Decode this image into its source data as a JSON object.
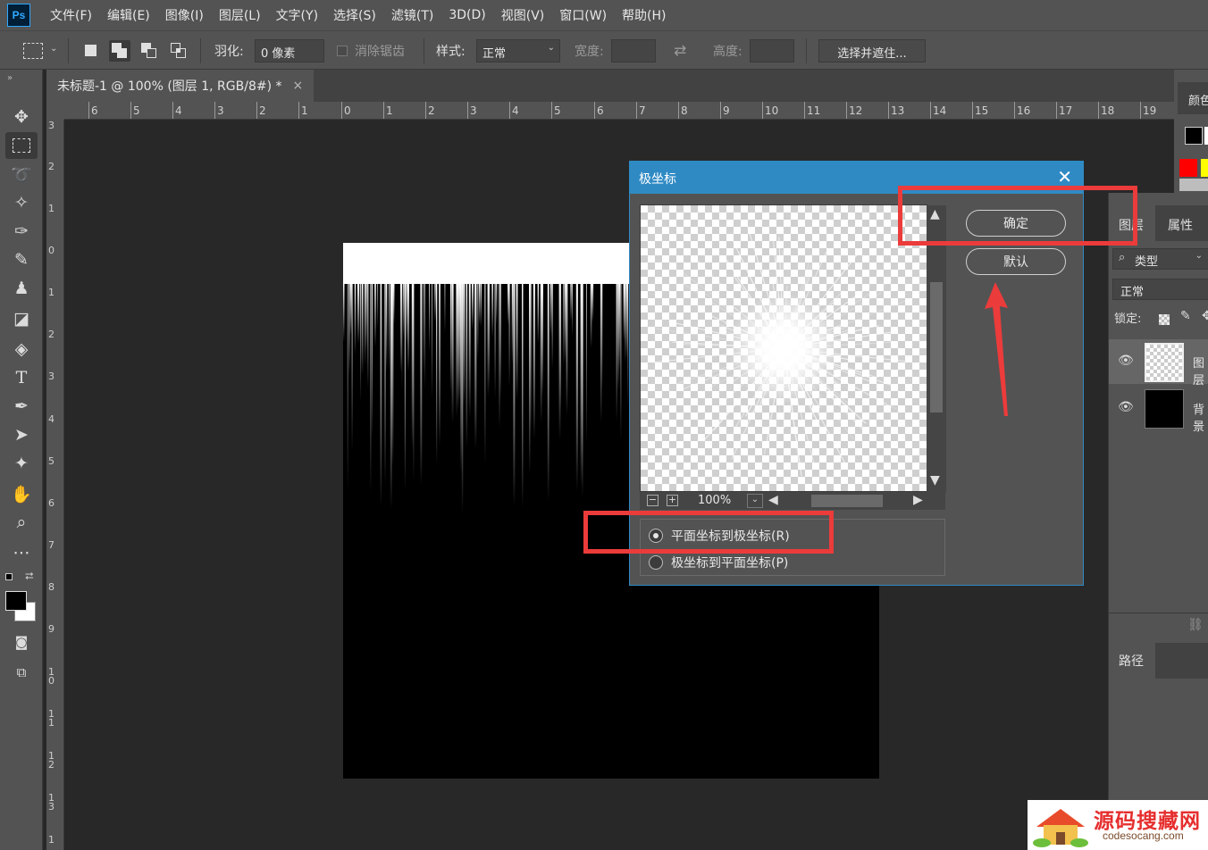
{
  "app": {
    "logo": "Ps"
  },
  "menu": [
    "文件(F)",
    "编辑(E)",
    "图像(I)",
    "图层(L)",
    "文字(Y)",
    "选择(S)",
    "滤镜(T)",
    "3D(D)",
    "视图(V)",
    "窗口(W)",
    "帮助(H)"
  ],
  "options": {
    "feather_label": "羽化:",
    "feather_value": "0 像素",
    "antialias_label": "消除锯齿",
    "style_label": "样式:",
    "style_value": "正常",
    "width_label": "宽度:",
    "height_label": "高度:",
    "select_mask_button": "选择并遮住..."
  },
  "document": {
    "tab_title": "未标题-1 @ 100% (图层 1, RGB/8#) *",
    "close": "×"
  },
  "rulers": {
    "h": [
      "6",
      "5",
      "4",
      "3",
      "2",
      "1",
      "0",
      "1",
      "2",
      "3",
      "4",
      "5",
      "6",
      "7",
      "8",
      "9",
      "10",
      "11",
      "12",
      "13",
      "14",
      "15",
      "16",
      "17",
      "18",
      "19"
    ],
    "v": [
      "3",
      "2",
      "1",
      "0",
      "1",
      "2",
      "3",
      "4",
      "5",
      "6",
      "7",
      "8",
      "9",
      "10",
      "11",
      "12",
      "13",
      "1"
    ]
  },
  "panels": {
    "color_tab": "颜色",
    "layers_tab": "图层",
    "properties_tab": "属性",
    "filter_kind": "类型",
    "blend_mode": "正常",
    "lock_label": "锁定:",
    "layer1_name": "图层",
    "background_name": "背景",
    "paths_tab": "路径"
  },
  "dialog": {
    "title": "极坐标",
    "close": "✕",
    "ok_button": "确定",
    "default_button": "默认",
    "zoom": "100%",
    "option_rect_to_polar": "平面坐标到极坐标(R)",
    "option_polar_to_rect": "极坐标到平面坐标(P)",
    "selected_option": "option_rect_to_polar"
  },
  "watermark": {
    "title": "源码搜藏网",
    "url": "codesocang.com"
  },
  "colors": {
    "accent": "#2f8ac4",
    "annotation_red": "#ec3b3b",
    "swatch_red": "#ff0000",
    "swatch_yellow": "#ffff00"
  }
}
